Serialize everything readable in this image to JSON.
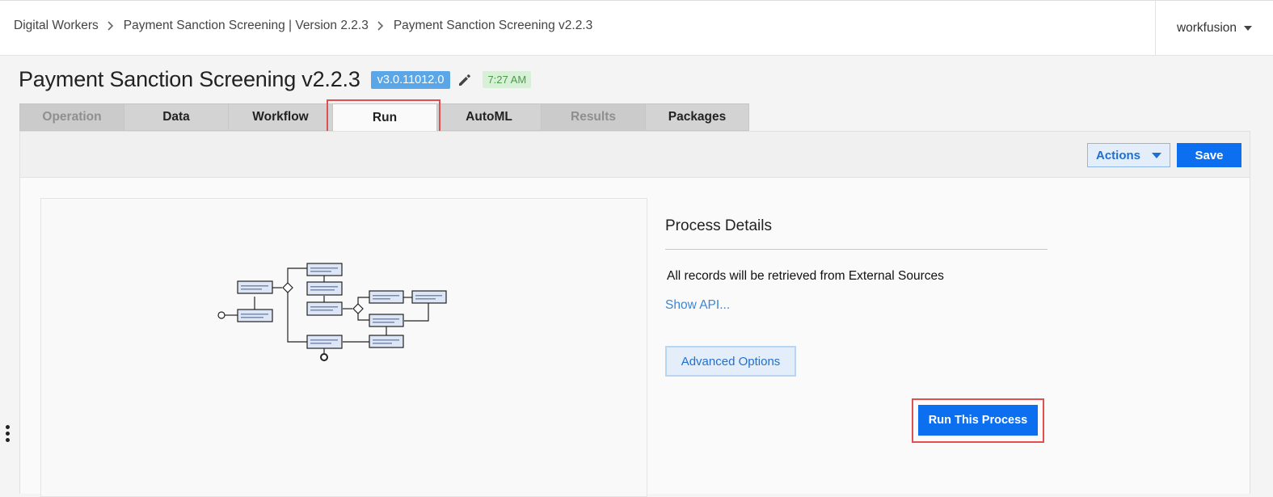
{
  "breadcrumb": {
    "items": [
      "Digital Workers",
      "Payment Sanction Screening | Version 2.2.3",
      "Payment Sanction Screening v2.2.3"
    ]
  },
  "user_menu": {
    "label": "workfusion"
  },
  "header": {
    "title": "Payment Sanction Screening v2.2.3",
    "version": "v3.0.11012.0",
    "time": "7:27 AM"
  },
  "tabs": [
    {
      "label": "Operation",
      "state": "disabled"
    },
    {
      "label": "Data",
      "state": "enabled"
    },
    {
      "label": "Workflow",
      "state": "enabled"
    },
    {
      "label": "Run",
      "state": "active"
    },
    {
      "label": "AutoML",
      "state": "enabled"
    },
    {
      "label": "Results",
      "state": "disabled"
    },
    {
      "label": "Packages",
      "state": "enabled"
    }
  ],
  "toolbar": {
    "actions_label": "Actions",
    "save_label": "Save"
  },
  "details": {
    "title": "Process Details",
    "records_text": "All records will be retrieved from External Sources",
    "show_api": "Show API...",
    "advanced_options": "Advanced Options",
    "run_button": "Run This Process"
  },
  "colors": {
    "primary": "#0b6ff0",
    "version_badge": "#5aa6e6",
    "time_badge_bg": "#d9f0d8",
    "highlight": "#e05050",
    "link": "#3a86d9"
  },
  "icons": [
    "chevron-right-icon",
    "caret-down-icon",
    "pencil-icon",
    "kebab-menu-icon"
  ]
}
